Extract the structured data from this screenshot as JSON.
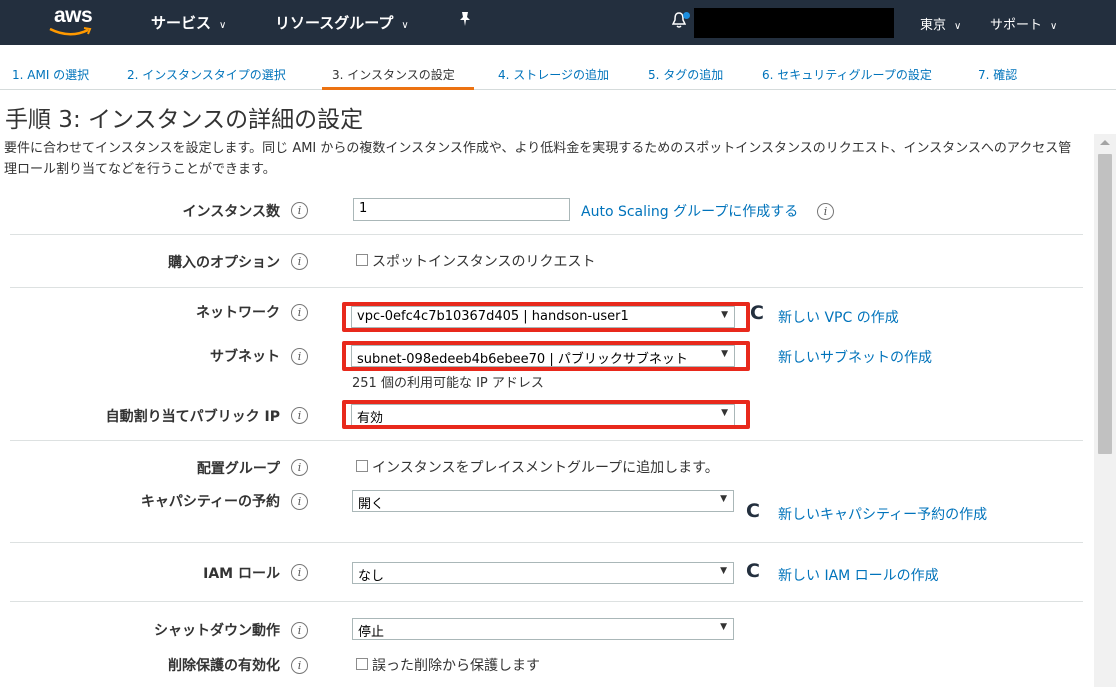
{
  "nav": {
    "logo": "aws",
    "services": "サービス",
    "resource_groups": "リソースグループ",
    "region": "東京",
    "support": "サポート"
  },
  "steps": [
    {
      "label": "1. AMI の選択"
    },
    {
      "label": "2. インスタンスタイプの選択"
    },
    {
      "label": "3. インスタンスの設定"
    },
    {
      "label": "4. ストレージの追加"
    },
    {
      "label": "5. タグの追加"
    },
    {
      "label": "6. セキュリティグループの設定"
    },
    {
      "label": "7. 確認"
    }
  ],
  "page": {
    "title": "手順 3: インスタンスの詳細の設定",
    "description": "要件に合わせてインスタンスを設定します。同じ AMI からの複数インスタンス作成や、より低料金を実現するためのスポットインスタンスのリクエスト、インスタンスへのアクセス管理ロール割り当てなどを行うことができます。"
  },
  "form": {
    "instance_count": {
      "label": "インスタンス数",
      "value": "1",
      "link": "Auto Scaling グループに作成する"
    },
    "purchase_option": {
      "label": "購入のオプション",
      "checkbox": "スポットインスタンスのリクエスト"
    },
    "network": {
      "label": "ネットワーク",
      "value": "vpc-0efc4c7b10367d405 | handson-user1",
      "link": "新しい VPC の作成"
    },
    "subnet": {
      "label": "サブネット",
      "value": "subnet-098edeeb4b6ebee70 | パブリックサブネット",
      "hint": "251 個の利用可能な IP アドレス",
      "link": "新しいサブネットの作成"
    },
    "auto_public_ip": {
      "label": "自動割り当てパブリック IP",
      "value": "有効"
    },
    "placement_group": {
      "label": "配置グループ",
      "checkbox": "インスタンスをプレイスメントグループに追加します。"
    },
    "capacity_reservation": {
      "label": "キャパシティーの予約",
      "value": "開く",
      "link": "新しいキャパシティー予約の作成"
    },
    "iam_role": {
      "label": "IAM ロール",
      "value": "なし",
      "link": "新しい IAM ロールの作成"
    },
    "shutdown_behavior": {
      "label": "シャットダウン動作",
      "value": "停止"
    },
    "termination_protection": {
      "label": "削除保護の有効化",
      "checkbox": "誤った削除から保護します"
    }
  },
  "colors": {
    "nav_bg": "#232f3e",
    "link": "#0073bb",
    "highlight": "#e8291c",
    "active_step": "#ec7211"
  }
}
